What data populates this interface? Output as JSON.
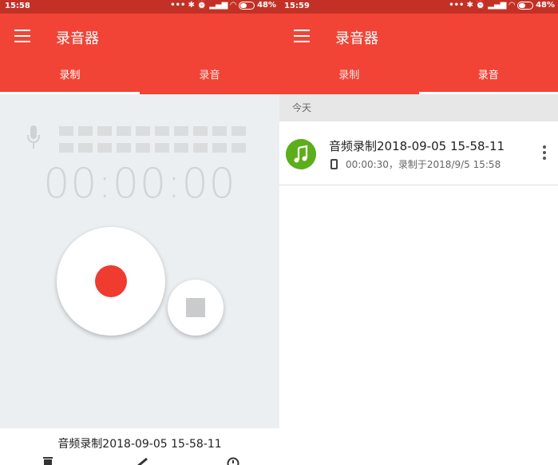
{
  "left": {
    "status": {
      "time": "15:58",
      "battery": "48%"
    },
    "app_title": "录音器",
    "tabs": [
      {
        "label": "录制",
        "active": true
      },
      {
        "label": "录音",
        "active": false
      }
    ],
    "timer": "00:00:00",
    "file_name": "音频录制2018-09-05 15-58-11",
    "bottom_icons": [
      "delete-icon",
      "edit-icon",
      "clock-icon"
    ]
  },
  "right": {
    "status": {
      "time": "15:59",
      "battery": "48%"
    },
    "app_title": "录音器",
    "tabs": [
      {
        "label": "录制",
        "active": false
      },
      {
        "label": "录音",
        "active": true
      }
    ],
    "section_header": "今天",
    "recordings": [
      {
        "title": "音频录制2018-09-05 15-58-11",
        "duration": "00:00:30",
        "subtitle_rest": "，录制于2018/9/5 15:58",
        "avatar_icon": "music-note-icon"
      }
    ]
  },
  "colors": {
    "status_bar": "#c33126",
    "app_bar": "#f14436",
    "record_dot": "#ef3b30",
    "avatar": "#5cae1a"
  }
}
